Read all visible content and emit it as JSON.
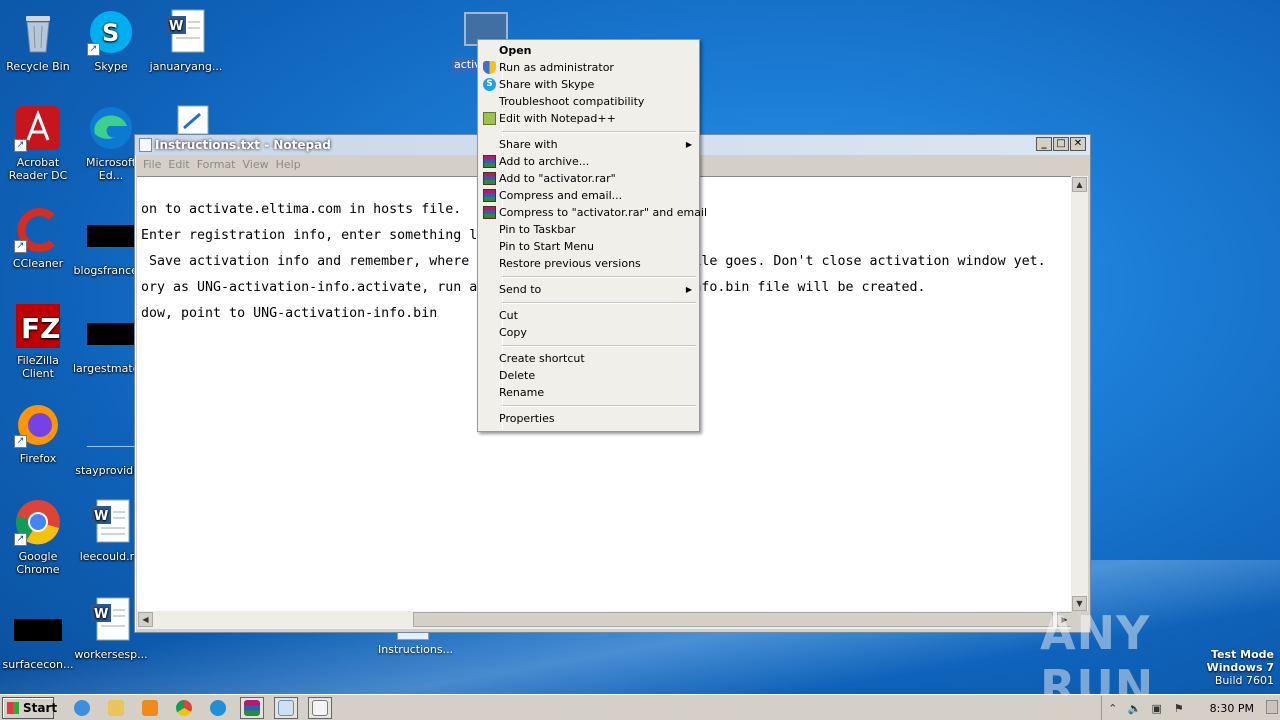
{
  "desktop": {
    "icons": [
      {
        "label": "Recycle Bin",
        "icon": "recycle-bin-icon"
      },
      {
        "label": "Skype",
        "icon": "skype-icon"
      },
      {
        "label": "januaryang...",
        "icon": "word-document-icon"
      },
      {
        "label": "Acrobat Reader DC",
        "icon": "acrobat-icon"
      },
      {
        "label": "Microsoft Ed...",
        "icon": "edge-icon"
      },
      {
        "label": "CCleaner",
        "icon": "ccleaner-icon"
      },
      {
        "label": "blogsfrance...",
        "icon": "black-file-icon"
      },
      {
        "label": "FileZilla Client",
        "icon": "filezilla-icon"
      },
      {
        "label": "largestmato...",
        "icon": "black-file-icon"
      },
      {
        "label": "Firefox",
        "icon": "firefox-icon"
      },
      {
        "label": "stayprovidi...",
        "icon": "file-icon"
      },
      {
        "label": "Google Chrome",
        "icon": "chrome-icon"
      },
      {
        "label": "leecould.rtf",
        "icon": "word-document-icon"
      },
      {
        "label": "surfacecon...",
        "icon": "black-file-icon"
      },
      {
        "label": "workersesp...",
        "icon": "word-document-icon"
      },
      {
        "label": "Instructions...",
        "icon": "notepad-file-icon"
      }
    ],
    "selected_label": "activ"
  },
  "notepad": {
    "title": "Instructions.txt - Notepad",
    "menu": [
      "File",
      "Edit",
      "Format",
      "View",
      "Help"
    ],
    "lines": [
      "on to activate.eltima.com in hosts file.",
      "Enter registration info, enter something l",
      " Save activation info and remember, where                           file goes. Don't close activation window yet.",
      "ory as UNG-activation-info.activate, run a                          info.bin file will be created.",
      "dow, point to UNG-activation-info.bin"
    ]
  },
  "context_menu": {
    "items": [
      {
        "label": "Open",
        "bold": true
      },
      {
        "label": "Run as administrator",
        "icon": "shield-icon"
      },
      {
        "label": "Share with Skype",
        "icon": "skype-icon"
      },
      {
        "label": "Troubleshoot compatibility"
      },
      {
        "label": "Edit with Notepad++",
        "icon": "notepad-plus-icon"
      },
      {
        "sep": true
      },
      {
        "label": "Share with",
        "submenu": true
      },
      {
        "label": "Add to archive...",
        "icon": "winrar-icon"
      },
      {
        "label": "Add to \"activator.rar\"",
        "icon": "winrar-icon"
      },
      {
        "label": "Compress and email...",
        "icon": "winrar-icon"
      },
      {
        "label": "Compress to \"activator.rar\" and email",
        "icon": "winrar-icon"
      },
      {
        "label": "Pin to Taskbar"
      },
      {
        "label": "Pin to Start Menu"
      },
      {
        "label": "Restore previous versions"
      },
      {
        "sep": true
      },
      {
        "label": "Send to",
        "submenu": true
      },
      {
        "sep": true
      },
      {
        "label": "Cut"
      },
      {
        "label": "Copy"
      },
      {
        "sep": true
      },
      {
        "label": "Create shortcut"
      },
      {
        "label": "Delete"
      },
      {
        "label": "Rename"
      },
      {
        "sep": true
      },
      {
        "label": "Properties"
      }
    ]
  },
  "watermark": "ANY RUN",
  "test_mode": {
    "line1": "Test Mode",
    "line2": "Windows 7",
    "line3": "Build 7601"
  },
  "taskbar": {
    "start_label": "Start",
    "pinned": [
      {
        "icon": "ie-icon",
        "color": "#3b8ee0"
      },
      {
        "icon": "explorer-icon",
        "color": "#e8c55a"
      },
      {
        "icon": "media-player-icon",
        "color": "#f08a1c"
      },
      {
        "icon": "chrome-icon",
        "color": "#db4437"
      },
      {
        "icon": "edge-icon",
        "color": "#1f8fd6"
      },
      {
        "icon": "winrar-icon",
        "color": "#8e2a6e"
      },
      {
        "icon": "notepad-icon",
        "color": "#cfe0f0"
      },
      {
        "icon": "app-window-icon",
        "color": "#7b7b7b"
      }
    ],
    "clock": "8:30 PM"
  }
}
